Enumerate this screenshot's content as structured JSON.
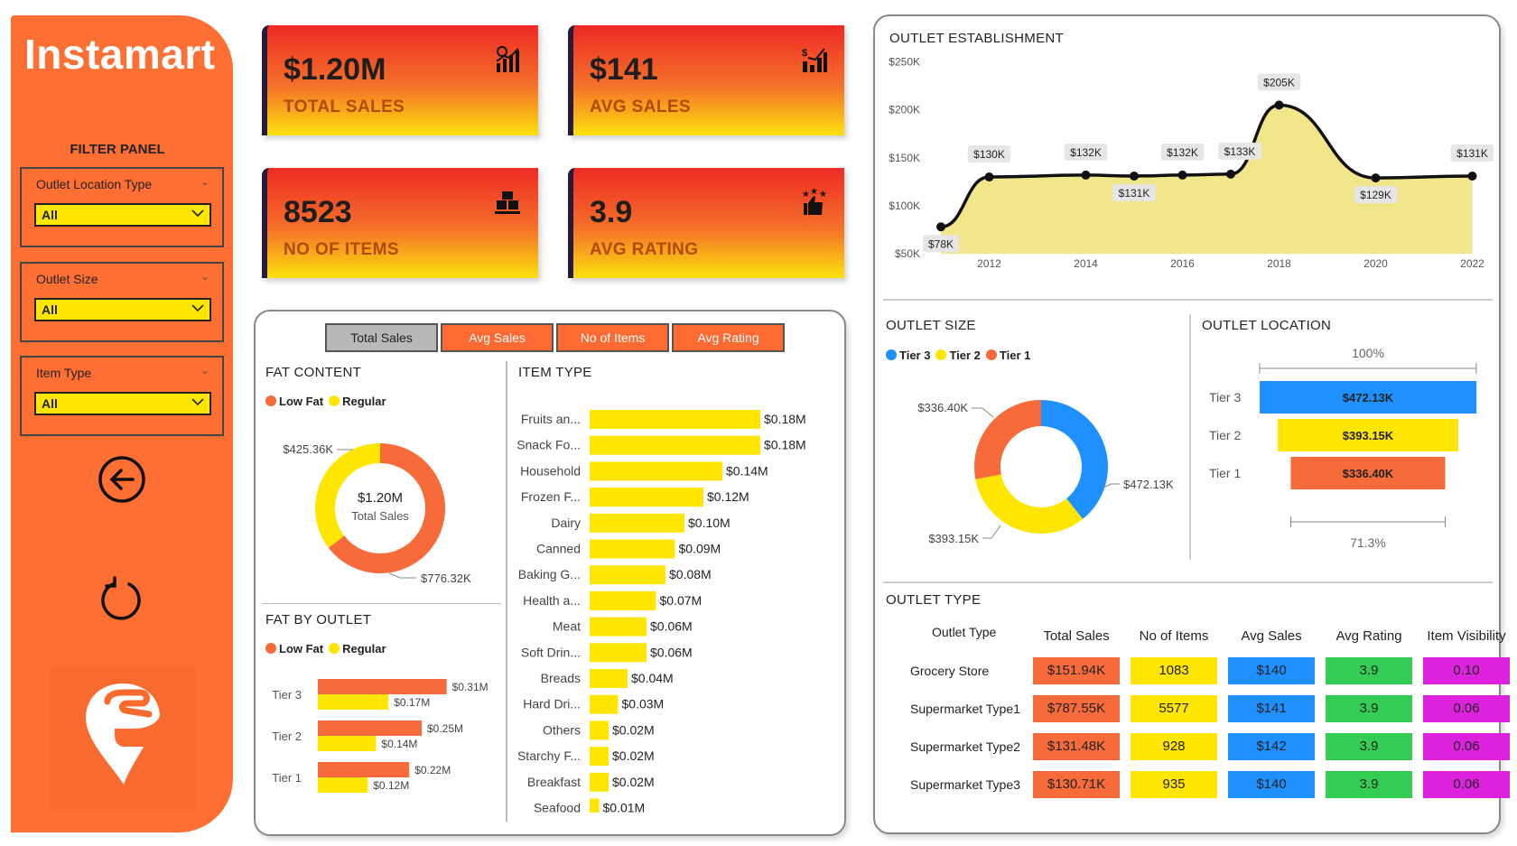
{
  "app": {
    "title": "Instamart",
    "filter_panel_title": "FILTER PANEL"
  },
  "filters": [
    {
      "label": "Outlet Location Type",
      "value": "All"
    },
    {
      "label": "Outlet Size",
      "value": "All"
    },
    {
      "label": "Item Type",
      "value": "All"
    }
  ],
  "kpis": [
    {
      "value": "$1.20M",
      "label": "TOTAL SALES",
      "icon": "sales-chart-icon"
    },
    {
      "value": "$141",
      "label": "AVG SALES",
      "icon": "dollar-bars-icon"
    },
    {
      "value": "8523",
      "label": "NO OF ITEMS",
      "icon": "boxes-icon"
    },
    {
      "value": "3.9",
      "label": "AVG RATING",
      "icon": "thumbs-up-stars-icon"
    }
  ],
  "tabs": [
    {
      "label": "Total Sales",
      "active": true
    },
    {
      "label": "Avg Sales",
      "active": false
    },
    {
      "label": "No of Items",
      "active": false
    },
    {
      "label": "Avg Rating",
      "active": false
    }
  ],
  "colors": {
    "orange": "#fe6a31",
    "yellow": "#ffe600",
    "blue": "#1e90ff",
    "green": "#33cc55",
    "magenta": "#dd22dd",
    "red_orange": "#f76b3a"
  },
  "fat_content": {
    "title": "FAT CONTENT",
    "legend": [
      "Low Fat",
      "Regular"
    ],
    "center_value": "$1.20M",
    "center_label": "Total Sales"
  },
  "fat_by_outlet": {
    "title": "FAT BY OUTLET",
    "legend": [
      "Low Fat",
      "Regular"
    ]
  },
  "item_type": {
    "title": "ITEM TYPE"
  },
  "outlet_establishment": {
    "title": "OUTLET ESTABLISHMENT"
  },
  "outlet_size": {
    "title": "OUTLET SIZE",
    "legend": [
      "Tier 3",
      "Tier 2",
      "Tier 1"
    ]
  },
  "outlet_location": {
    "title": "OUTLET LOCATION",
    "top_pct": "100%",
    "bottom_pct": "71.3%"
  },
  "outlet_type": {
    "title": "OUTLET TYPE",
    "columns": [
      "Outlet Type",
      "Total Sales",
      "No of Items",
      "Avg Sales",
      "Avg Rating",
      "Item Visibility"
    ],
    "rows": [
      [
        "Grocery Store",
        "$151.94K",
        "1083",
        "$140",
        "3.9",
        "0.10"
      ],
      [
        "Supermarket Type1",
        "$787.55K",
        "5577",
        "$141",
        "3.9",
        "0.06"
      ],
      [
        "Supermarket Type2",
        "$131.48K",
        "928",
        "$142",
        "3.9",
        "0.06"
      ],
      [
        "Supermarket Type3",
        "$130.71K",
        "935",
        "$140",
        "3.9",
        "0.06"
      ]
    ]
  },
  "chart_data": [
    {
      "type": "pie",
      "title": "FAT CONTENT",
      "categories": [
        "Low Fat",
        "Regular"
      ],
      "values": [
        776.32,
        425.36
      ],
      "labels": [
        "$776.32K",
        "$425.36K"
      ],
      "unit": "K"
    },
    {
      "type": "bar",
      "title": "FAT BY OUTLET",
      "orientation": "horizontal",
      "categories": [
        "Tier 3",
        "Tier 2",
        "Tier 1"
      ],
      "series": [
        {
          "name": "Low Fat",
          "values": [
            0.31,
            0.25,
            0.22
          ],
          "labels": [
            "$0.31M",
            "$0.25M",
            "$0.22M"
          ]
        },
        {
          "name": "Regular",
          "values": [
            0.17,
            0.14,
            0.12
          ],
          "labels": [
            "$0.17M",
            "$0.14M",
            "$0.12M"
          ]
        }
      ]
    },
    {
      "type": "bar",
      "title": "ITEM TYPE",
      "orientation": "horizontal",
      "categories": [
        "Fruits an...",
        "Snack Fo...",
        "Household",
        "Frozen F...",
        "Dairy",
        "Canned",
        "Baking G...",
        "Health a...",
        "Meat",
        "Soft Drin...",
        "Breads",
        "Hard Dri...",
        "Others",
        "Starchy F...",
        "Breakfast",
        "Seafood"
      ],
      "values": [
        0.18,
        0.18,
        0.14,
        0.12,
        0.1,
        0.09,
        0.08,
        0.07,
        0.06,
        0.06,
        0.04,
        0.03,
        0.02,
        0.02,
        0.02,
        0.01
      ],
      "labels": [
        "$0.18M",
        "$0.18M",
        "$0.14M",
        "$0.12M",
        "$0.10M",
        "$0.09M",
        "$0.08M",
        "$0.07M",
        "$0.06M",
        "$0.06M",
        "$0.04M",
        "$0.03M",
        "$0.02M",
        "$0.02M",
        "$0.02M",
        "$0.01M"
      ]
    },
    {
      "type": "area",
      "title": "OUTLET ESTABLISHMENT",
      "x": [
        2011,
        2012,
        2014,
        2015,
        2016,
        2017,
        2018,
        2020,
        2022
      ],
      "values": [
        78,
        130,
        132,
        131,
        132,
        133,
        205,
        129,
        131
      ],
      "labels": [
        "$78K",
        "$130K",
        "$132K",
        "$131K",
        "$132K",
        "$133K",
        "$205K",
        "$129K",
        "$131K"
      ],
      "xticks": [
        "2012",
        "2014",
        "2016",
        "2018",
        "2020",
        "2022"
      ],
      "yticks": [
        "$50K",
        "$100K",
        "$150K",
        "$200K",
        "$250K"
      ],
      "ylim": [
        50,
        250
      ]
    },
    {
      "type": "pie",
      "title": "OUTLET SIZE",
      "categories": [
        "Tier 3",
        "Tier 2",
        "Tier 1"
      ],
      "values": [
        472.13,
        393.15,
        336.4
      ],
      "labels": [
        "$472.13K",
        "$393.15K",
        "$336.40K"
      ]
    },
    {
      "type": "bar",
      "title": "OUTLET LOCATION",
      "subtype": "funnel",
      "categories": [
        "Tier 3",
        "Tier 2",
        "Tier 1"
      ],
      "values": [
        472.13,
        393.15,
        336.4
      ],
      "labels": [
        "$472.13K",
        "$393.15K",
        "$336.40K"
      ]
    }
  ]
}
